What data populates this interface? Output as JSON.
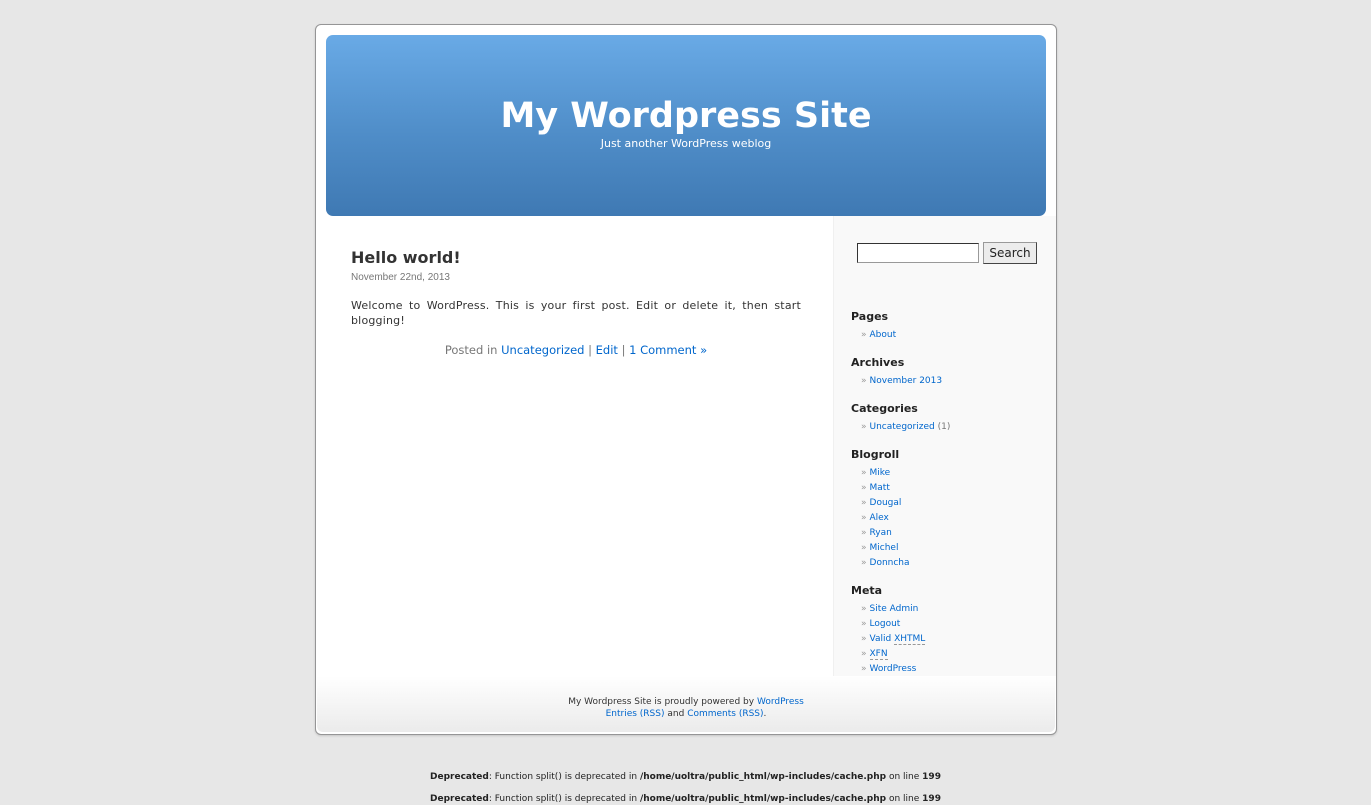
{
  "header": {
    "title": "My Wordpress Site",
    "description": "Just another WordPress weblog"
  },
  "post": {
    "title": "Hello world!",
    "date": "November 22nd, 2013",
    "body": "Welcome to WordPress. This is your first post. Edit or delete it, then start blogging!",
    "meta_prefix": "Posted in",
    "category_link": "Uncategorized",
    "separator": "|",
    "edit_link": "Edit",
    "comments_link": "1 Comment »"
  },
  "sidebar": {
    "search": {
      "value": "",
      "button_label": "Search"
    },
    "bullet": "»",
    "pages": {
      "title": "Pages",
      "items": [
        "About"
      ]
    },
    "archives": {
      "title": "Archives",
      "items": [
        "November 2013"
      ]
    },
    "categories": {
      "title": "Categories",
      "items": [
        {
          "label": "Uncategorized",
          "count": "(1)"
        }
      ]
    },
    "blogroll": {
      "title": "Blogroll",
      "items": [
        "Mike",
        "Matt",
        "Dougal",
        "Alex",
        "Ryan",
        "Michel",
        "Donncha"
      ]
    },
    "meta": {
      "title": "Meta",
      "site_admin": "Site Admin",
      "logout": "Logout",
      "valid_prefix": "Valid",
      "xhtml": "XHTML",
      "xfn": "XFN",
      "wordpress": "WordPress"
    }
  },
  "footer": {
    "powered_text": "My Wordpress Site is proudly powered by",
    "wordpress_link": "WordPress",
    "entries_rss": "Entries (RSS)",
    "and": "and",
    "comments_rss": "Comments (RSS)",
    "period": "."
  },
  "notices": {
    "label": "Deprecated",
    "message": ": Function split() is deprecated in",
    "path": "/home/uoltra/public_html/wp-includes/cache.php",
    "on_line": "on line",
    "line": "199"
  },
  "colors": {
    "link": "#0066cc",
    "header_top": "#69aae6",
    "header_bottom": "#3f79b3",
    "background": "#e7e7e7"
  }
}
